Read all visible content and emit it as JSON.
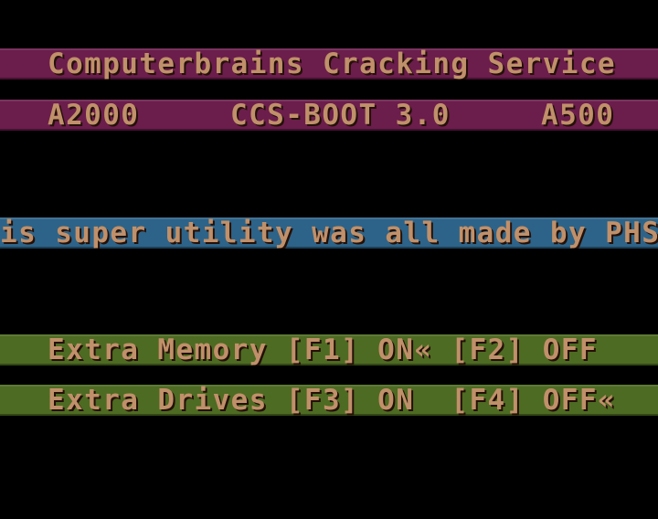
{
  "title_bar": {
    "text": "Computerbrains Cracking Service"
  },
  "boot_bar": {
    "left": "A2000",
    "center": "CCS-BOOT 3.0",
    "right": "A500"
  },
  "scroller": {
    "text": "is super utility was all made by PHS of"
  },
  "options": {
    "memory": "Extra Memory [F1] ON« [F2] OFF",
    "drives": "Extra Drives [F3] ON  [F4] OFF«"
  },
  "colors": {
    "background": "#000000",
    "title_bar": "#6b1d4c",
    "scroller_bar": "#2d6388",
    "option_bar": "#4d6b22",
    "text": "#c0906a"
  }
}
